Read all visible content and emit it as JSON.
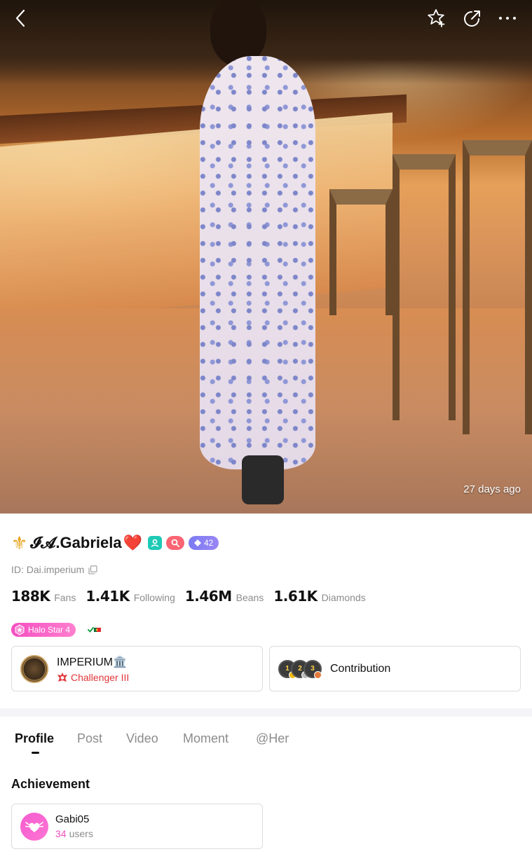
{
  "hero": {
    "time_ago": "27 days ago"
  },
  "toolbar": {
    "back_icon": "chevron-left-icon",
    "favorite_icon": "star-plus-icon",
    "share_icon": "share-icon",
    "more_icon": "more-horizontal-icon"
  },
  "profile": {
    "name_prefix": "⚜",
    "name": "𝓘𝓐.Gabriela",
    "name_suffix": "❤️",
    "level": "42",
    "id": "ID: Dai.imperium",
    "halo": "Halo Star 4"
  },
  "stats": [
    {
      "value": "188K",
      "label": "Fans"
    },
    {
      "value": "1.41K",
      "label": "Following"
    },
    {
      "value": "1.46M",
      "label": "Beans"
    },
    {
      "value": "1.61K",
      "label": "Diamonds"
    }
  ],
  "family": {
    "name": "IMPERIUM🏛️",
    "rank": "Challenger III"
  },
  "contribution": {
    "label": "Contribution",
    "medals": [
      "1",
      "2",
      "3"
    ]
  },
  "tabs": [
    "Profile",
    "Post",
    "Video",
    "Moment",
    "@Her"
  ],
  "achievement": {
    "title": "Achievement",
    "name": "Gabi05",
    "count": "34",
    "count_label": "users"
  },
  "colors": {
    "accent_pink": "#f04fc0",
    "rank_red": "#e0373b",
    "level_purple": "#7b7bf1",
    "teal_badge": "#1ec9b5"
  }
}
